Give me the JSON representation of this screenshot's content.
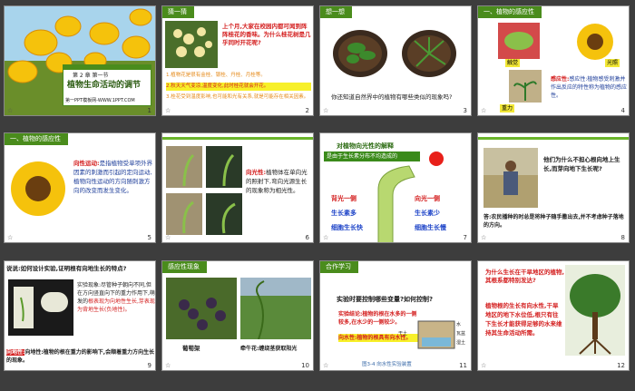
{
  "slides": [
    {
      "num": "1",
      "kicker": "第 2 章 第一节",
      "title": "植物生命活动的调节",
      "footer": "第一PPT模板网-WWW.1PPT.COM"
    },
    {
      "num": "2",
      "label": "猜一猜",
      "q": "上个月,大家在校园内都可闻到阵阵桂花的香味。为什么桂花树是几乎同时开花呢?",
      "a1": "1.植物花是很有金桂、银桂、丹桂、月桂等。",
      "a2": "2.秋天天气变凉,温度变化,此时桂花就会开花。",
      "a3": "3.桂花受到温度影响,也可能和光有关系,就是可能存在相关因素。"
    },
    {
      "num": "3",
      "label": "想一想",
      "q": "你还知道自然界中的植物有哪些类似的现象吗?"
    },
    {
      "num": "4",
      "label": "一、植物的感应性",
      "l1": "触觉",
      "l2": "光照",
      "l3": "重力",
      "def": "感应性:植物感受刺激并作出反应的特性称为植物的感应性。",
      "def_head": "感应性:"
    },
    {
      "num": "5",
      "label": "一、植物的感应性",
      "head": "向性运动:",
      "body": "是指植物受单项外界因素的刺激而引起的定向运动,植物向性运动的方向随刺激方向的改变而发生变化。"
    },
    {
      "num": "6",
      "head": "向光性:",
      "body": "植物体在单向光的照射下,弯向光源生长的现象称为相光性。"
    },
    {
      "num": "7",
      "title": "对植物向光性的解释",
      "sub": "是由于生长素分布不均造成的",
      "l1": "背光一侧",
      "l2": "生长素多",
      "l3": "细胞生长快",
      "r1": "向光一侧",
      "r2": "生长素少",
      "r3": "细胞生长慢"
    },
    {
      "num": "8",
      "q": "他们为什么不担心根向地上生长,而芽向地下生长呢?",
      "ans": "答:农民播种的时总是将种子随手撒出去,并不考虑种子落地的方向。"
    },
    {
      "num": "9",
      "title": "说说:如何设计实验,证明根有向地生长的特点?",
      "body": "实验现象:尽管种子朝向不同,但在方向竖直向下的重力作用下,萌发的",
      "red": "根表现为向地性生长,芽表现为背地生长(负地性)。",
      "foot": "向地性:植物的根在重力的影响下,会顺着重力方向生长的现象。",
      "foot_head": "向地性:"
    },
    {
      "num": "10",
      "label": "感应性现象",
      "c1": "葡萄架",
      "c2": "牵牛花:缠绕茎获取阳光"
    },
    {
      "num": "11",
      "label": "合作学习",
      "q": "实验时要控制哪些变量?如何控制?",
      "red": "实验结论:植物的根在水多的一侧较多,在水少的一侧较少。",
      "yel": "向水性:植物的根具有向水性。",
      "cap": "图3-4 向水性实验装置",
      "w1": "水",
      "w2": "干土",
      "w3": "瓦盆",
      "w4": "湿土"
    },
    {
      "num": "12",
      "q": "为什么生长在干旱地区的植物,其根系都特别发达?",
      "a": "植物根的生长有向水性,干旱地区的地下水位低,根只有往下生长才能获得足够的水来维持其生命活动所需。"
    }
  ]
}
